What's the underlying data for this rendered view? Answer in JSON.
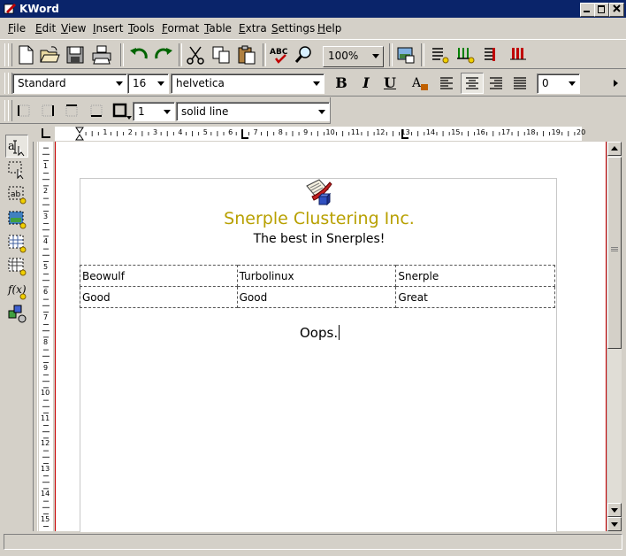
{
  "window": {
    "title": "KWord"
  },
  "menu": {
    "items": [
      "File",
      "Edit",
      "View",
      "Insert",
      "Tools",
      "Format",
      "Table",
      "Extra",
      "Settings",
      "Help"
    ]
  },
  "toolbar": {
    "zoom": "100%",
    "icons": [
      "new-document-icon",
      "open-folder-icon",
      "save-icon",
      "print-icon",
      "undo-icon",
      "redo-icon",
      "cut-icon",
      "copy-icon",
      "paste-icon",
      "spellcheck-icon",
      "find-icon",
      "image-icon",
      "insert-frame-icon",
      "table-icon",
      "formula-icon",
      "book-icon"
    ]
  },
  "format": {
    "style": "Standard",
    "size": "16",
    "font": "helvetica",
    "bold_label": "B",
    "italic_label": "I",
    "underline_label": "U",
    "spacing": "0"
  },
  "border": {
    "width": "1",
    "style": "solid line"
  },
  "ruler": {
    "h_numbers": [
      "1",
      "2",
      "3",
      "4",
      "5",
      "6",
      "7",
      "8",
      "9",
      "10",
      "11",
      "12",
      "13",
      "14",
      "15",
      "16",
      "17",
      "18",
      "19",
      "20"
    ],
    "v_numbers": [
      "1",
      "2",
      "3",
      "4",
      "5",
      "6",
      "7",
      "8",
      "9",
      "10",
      "11",
      "12",
      "13",
      "14",
      "15"
    ]
  },
  "document": {
    "company": "Snerple Clustering Inc.",
    "tagline": "The best in Snerples!",
    "table": [
      [
        "Beowulf",
        "Turbolinux",
        "Snerple"
      ],
      [
        "Good",
        "Good",
        "Great"
      ]
    ],
    "body_text": "Oops."
  }
}
